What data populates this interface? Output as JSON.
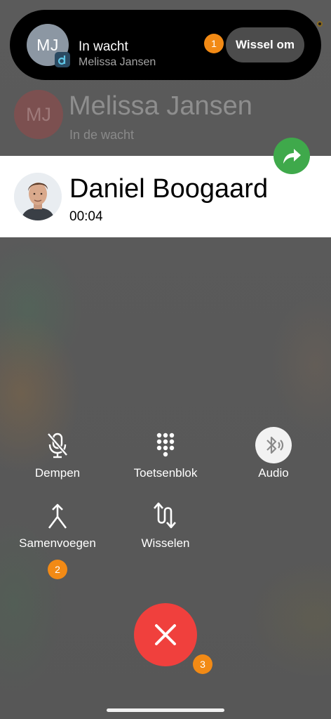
{
  "banner": {
    "avatar_initials": "MJ",
    "status": "In wacht",
    "name": "Melissa Jansen",
    "switch_label": "Wissel om"
  },
  "held_call": {
    "avatar_initials": "MJ",
    "name": "Melissa Jansen",
    "status": "In de wacht"
  },
  "active_call": {
    "name": "Daniel Boogaard",
    "duration": "00:04"
  },
  "controls": {
    "mute_label": "Dempen",
    "keypad_label": "Toetsenblok",
    "audio_label": "Audio",
    "merge_label": "Samenvoegen",
    "swap_label": "Wisselen"
  },
  "markers": [
    "1",
    "2",
    "3"
  ],
  "colors": {
    "hangup": "#f0403d",
    "forward": "#3fa94b",
    "marker": "#f28a15",
    "card": "#ffffff"
  },
  "icons": {
    "mute": "microphone-slash-icon",
    "keypad": "dialpad-icon",
    "audio": "bluetooth-audio-icon",
    "merge": "merge-arrows-icon",
    "swap": "swap-arrows-icon",
    "hangup": "close-x-icon",
    "forward": "forward-arrow-icon"
  }
}
